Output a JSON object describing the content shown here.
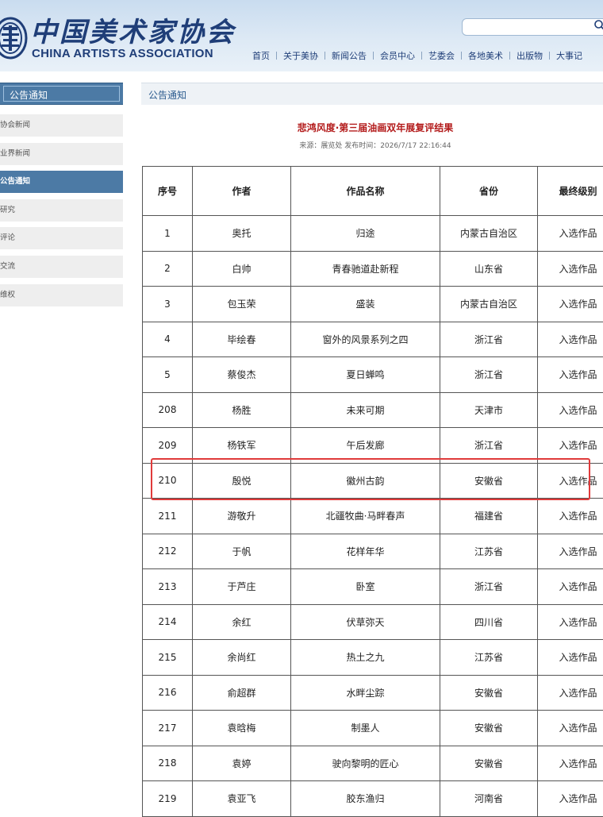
{
  "header": {
    "logo_cn": "中国美术家协会",
    "logo_en": "CHINA ARTISTS ASSOCIATION",
    "search_placeholder": "",
    "nav": [
      "首页",
      "关于美协",
      "新闻公告",
      "会员中心",
      "艺委会",
      "各地美术",
      "出版物",
      "大事记"
    ]
  },
  "sidebar": {
    "title": "公告通知",
    "items": [
      {
        "label": "协会新闻",
        "active": false
      },
      {
        "label": "业界新闻",
        "active": false
      },
      {
        "label": "公告通知",
        "active": true
      },
      {
        "label": "研究",
        "active": false
      },
      {
        "label": "评论",
        "active": false
      },
      {
        "label": "交流",
        "active": false
      },
      {
        "label": "维权",
        "active": false
      }
    ]
  },
  "main": {
    "breadcrumb": "公告通知",
    "article_title": "悲鸿风度·第三届油画双年展复评结果",
    "article_meta": "来源：展览处 发布时间：2026/7/17 22:16:44",
    "table": {
      "headers": [
        "序号",
        "作者",
        "作品名称",
        "省份",
        "最终级别"
      ],
      "rows": [
        [
          "1",
          "奥托",
          "归途",
          "内蒙古自治区",
          "入选作品"
        ],
        [
          "2",
          "白帅",
          "青春驰道赴新程",
          "山东省",
          "入选作品"
        ],
        [
          "3",
          "包玉荣",
          "盛装",
          "内蒙古自治区",
          "入选作品"
        ],
        [
          "4",
          "毕绘春",
          "窗外的风景系列之四",
          "浙江省",
          "入选作品"
        ],
        [
          "5",
          "蔡俊杰",
          "夏日蝉鸣",
          "浙江省",
          "入选作品"
        ],
        [
          "208",
          "杨胜",
          "未来可期",
          "天津市",
          "入选作品"
        ],
        [
          "209",
          "杨铁军",
          "午后发廊",
          "浙江省",
          "入选作品"
        ],
        [
          "210",
          "殷悦",
          "徽州古韵",
          "安徽省",
          "入选作品"
        ],
        [
          "211",
          "游敬升",
          "北疆牧曲·马畔春声",
          "福建省",
          "入选作品"
        ],
        [
          "212",
          "于帆",
          "花样年华",
          "江苏省",
          "入选作品"
        ],
        [
          "213",
          "于芦庄",
          "卧室",
          "浙江省",
          "入选作品"
        ],
        [
          "214",
          "余红",
          "伏草弥天",
          "四川省",
          "入选作品"
        ],
        [
          "215",
          "余尚红",
          "热土之九",
          "江苏省",
          "入选作品"
        ],
        [
          "216",
          "俞超群",
          "水畔尘踪",
          "安徽省",
          "入选作品"
        ],
        [
          "217",
          "袁晗梅",
          "制墨人",
          "安徽省",
          "入选作品"
        ],
        [
          "218",
          "袁婷",
          "驶向黎明的匠心",
          "安徽省",
          "入选作品"
        ],
        [
          "219",
          "袁亚飞",
          "胶东渔归",
          "河南省",
          "入选作品"
        ]
      ]
    },
    "highlighted_row_index": 7
  },
  "colors": {
    "brand_blue": "#1f3e78",
    "sidebar_active": "#4c7aa5",
    "title_red": "#b31b1b",
    "highlight_red": "#e03b3b"
  }
}
